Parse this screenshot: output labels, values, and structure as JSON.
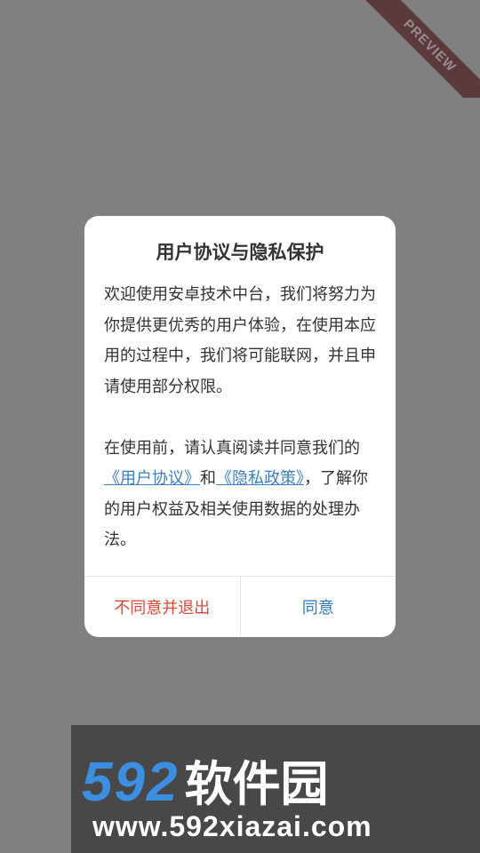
{
  "preview_badge": "PREVIEW",
  "dialog": {
    "title": "用户协议与隐私保护",
    "para1": "欢迎使用安卓技术中台，我们将努力为你提供更优秀的用户体验，在使用本应用的过程中，我们将可能联网，并且申请使用部分权限。",
    "para2_prefix": "在使用前，请认真阅读并同意我们的",
    "user_agreement_link": "《用户协议》",
    "conjunction": "和",
    "privacy_policy_link": "《隐私政策》",
    "para2_suffix": "，了解你的用户权益及相关使用数据的处理办法。",
    "decline_label": "不同意并退出",
    "accept_label": "同意"
  },
  "watermark": {
    "logo_number": "592",
    "logo_text": "软件园",
    "url": "www.592xiazai.com"
  },
  "colors": {
    "backdrop": "#808080",
    "decline": "#d94a3a",
    "accept": "#2a7ac4",
    "link": "#3d7fc1"
  }
}
